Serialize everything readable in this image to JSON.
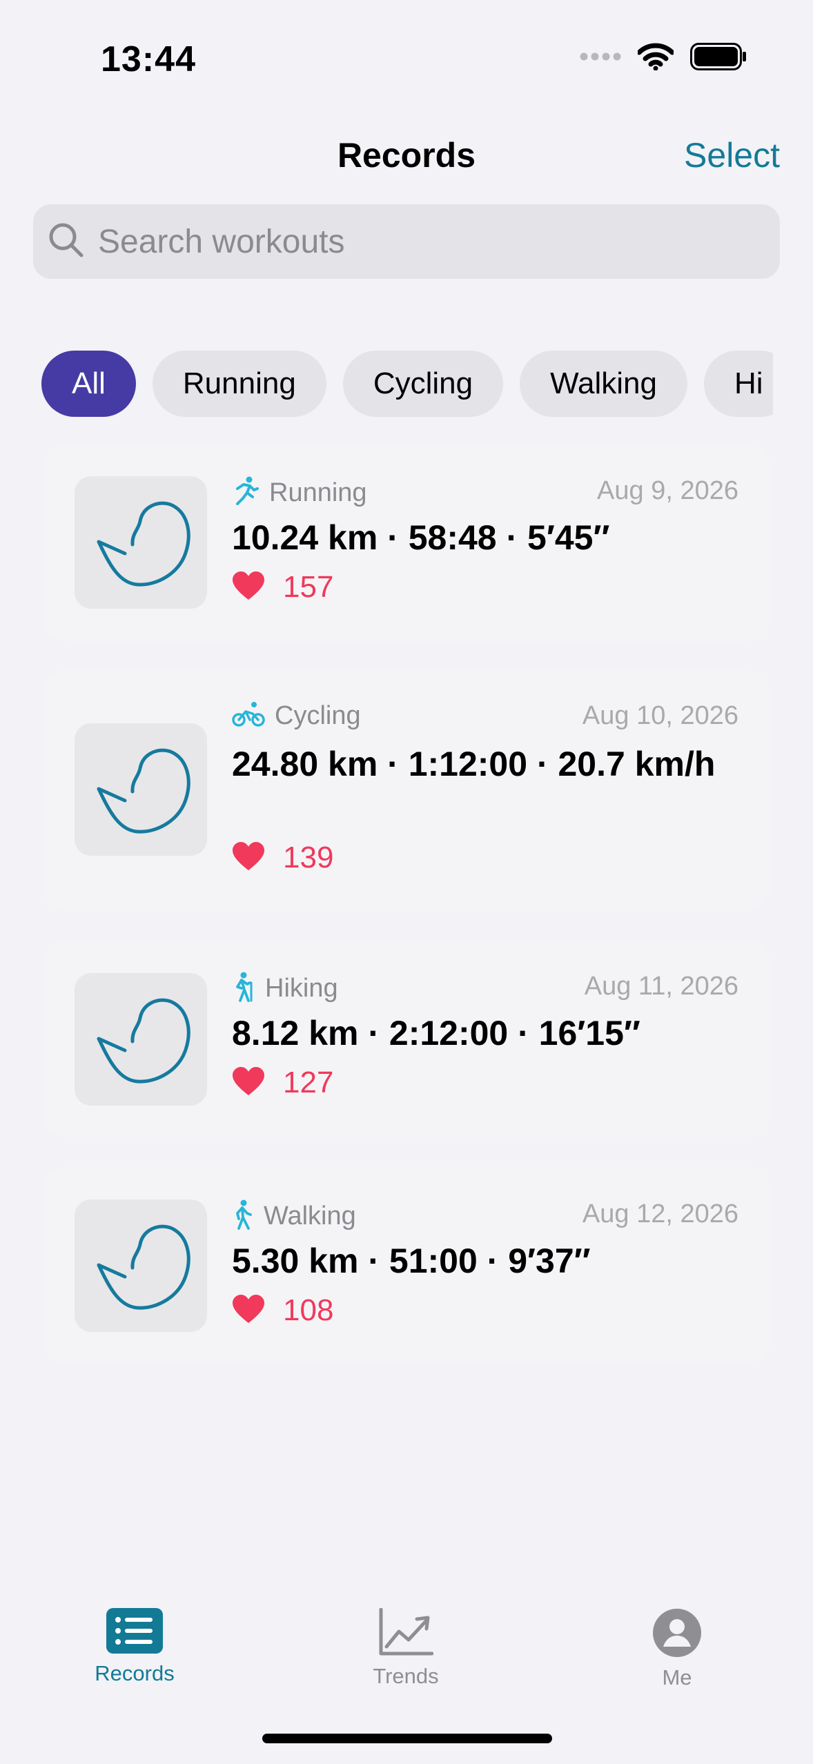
{
  "status": {
    "time": "13:44"
  },
  "nav": {
    "title": "Records",
    "select_label": "Select"
  },
  "search": {
    "placeholder": "Search workouts",
    "value": ""
  },
  "filters": [
    {
      "label": "All",
      "active": true
    },
    {
      "label": "Running",
      "active": false
    },
    {
      "label": "Cycling",
      "active": false
    },
    {
      "label": "Walking",
      "active": false
    },
    {
      "label": "Hi",
      "active": false
    }
  ],
  "workouts": [
    {
      "activity": "Running",
      "icon": "running-icon",
      "date": "Aug 9, 2026",
      "stats": "10.24 km · 58:48 · 5′45″",
      "heart_rate": "157"
    },
    {
      "activity": "Cycling",
      "icon": "cycling-icon",
      "date": "Aug 10, 2026",
      "stats": "24.80 km · 1:12:00 · 20.7 km/h",
      "heart_rate": "139"
    },
    {
      "activity": "Hiking",
      "icon": "hiking-icon",
      "date": "Aug 11, 2026",
      "stats": "8.12 km · 2:12:00 · 16′15″",
      "heart_rate": "127"
    },
    {
      "activity": "Walking",
      "icon": "walking-icon",
      "date": "Aug 12, 2026",
      "stats": "5.30 km · 51:00 · 9′37″",
      "heart_rate": "108"
    }
  ],
  "tabs": [
    {
      "label": "Records",
      "icon": "list-icon",
      "active": true
    },
    {
      "label": "Trends",
      "icon": "trend-chart-icon",
      "active": false
    },
    {
      "label": "Me",
      "icon": "person-icon",
      "active": false
    }
  ],
  "colors": {
    "accent": "#137a96",
    "chip_active": "#463ba4",
    "heart": "#f0395b",
    "activity_icon": "#27b5d8",
    "route": "#167a9e"
  }
}
